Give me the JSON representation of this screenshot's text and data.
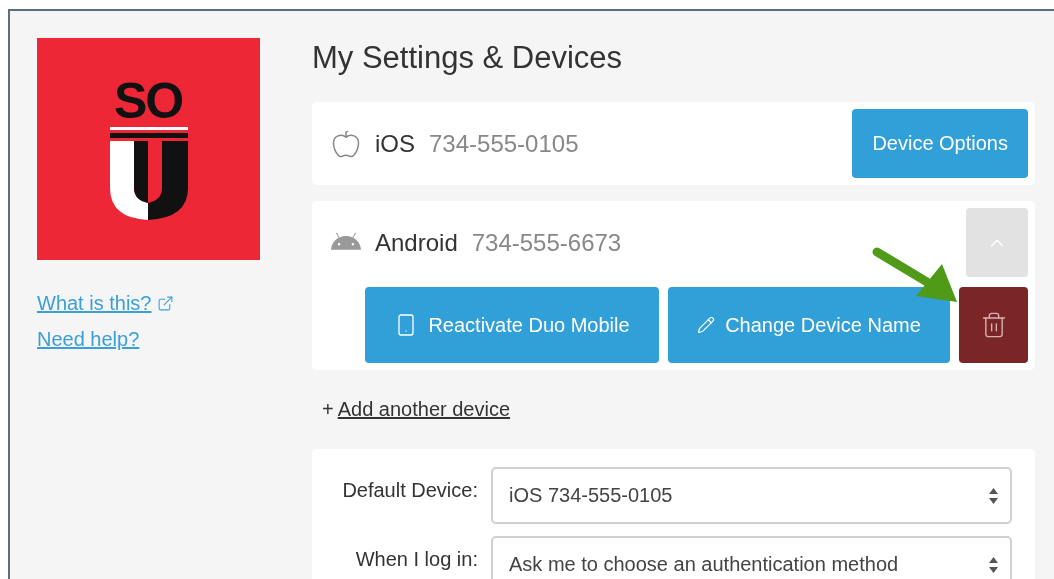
{
  "logo": {
    "text": "SO"
  },
  "links": [
    {
      "label": "What is this?",
      "external": true
    },
    {
      "label": "Need help?",
      "external": false
    }
  ],
  "title": "My Settings & Devices",
  "devices": [
    {
      "kind": "ios",
      "name": "iOS",
      "number": "734-555-0105",
      "expanded": false,
      "options_button": "Device Options"
    },
    {
      "kind": "android",
      "name": "Android",
      "number": "734-555-6673",
      "expanded": true,
      "actions": [
        {
          "kind": "reactivate",
          "label": "Reactivate Duo Mobile"
        },
        {
          "kind": "rename",
          "label": "Change Device Name"
        },
        {
          "kind": "delete"
        }
      ]
    }
  ],
  "add_device": {
    "prefix": "+",
    "label": "Add another device"
  },
  "settings": [
    {
      "label": "Default Device:",
      "value": "iOS 734-555-0105"
    },
    {
      "label": "When I log in:",
      "value": "Ask me to choose an authentication method"
    }
  ],
  "annotation": {
    "kind": "arrow"
  }
}
